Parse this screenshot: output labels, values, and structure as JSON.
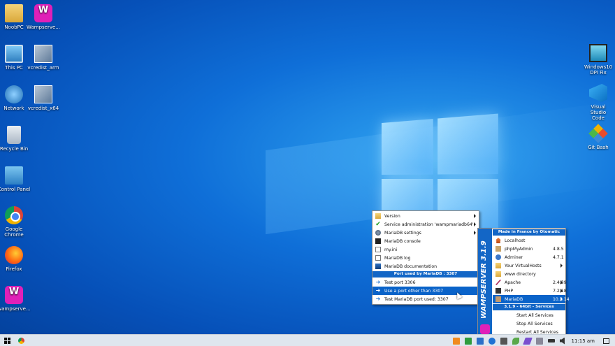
{
  "desktop": {
    "icons_left": [
      {
        "label": "NoobPC",
        "icon": "user-folder-icon"
      },
      {
        "label": "Wampserve...",
        "icon": "wampserver-icon"
      },
      {
        "label": "This PC",
        "icon": "this-pc-icon"
      },
      {
        "label": "vcredist_arm",
        "icon": "installer-icon"
      },
      {
        "label": "Network",
        "icon": "network-icon"
      },
      {
        "label": "vcredist_x64",
        "icon": "installer-icon"
      },
      {
        "label": "Recycle Bin",
        "icon": "recycle-bin-icon"
      },
      {
        "label": "Control Panel",
        "icon": "control-panel-icon"
      },
      {
        "label": "Google Chrome",
        "icon": "chrome-icon"
      },
      {
        "label": "Firefox",
        "icon": "firefox-icon"
      },
      {
        "label": "wampserve...",
        "icon": "wampserver-icon"
      }
    ],
    "icons_right": [
      {
        "label": "Windows10 DPI Fix",
        "icon": "dpi-fix-icon"
      },
      {
        "label": "Visual Studio Code",
        "icon": "vscode-icon"
      },
      {
        "label": "Git Bash",
        "icon": "git-bash-icon"
      }
    ]
  },
  "mariadb_menu": {
    "items": [
      {
        "label": "Version",
        "submenu": true
      },
      {
        "label": "Service administration 'wampmariadb64'",
        "submenu": true
      },
      {
        "label": "MariaDB settings",
        "submenu": true
      },
      {
        "label": "MariaDB console"
      },
      {
        "label": "my.ini"
      },
      {
        "label": "MariaDB log"
      },
      {
        "label": "MariaDB documentation"
      }
    ],
    "port_header": "Port used by MariaDB : 3307",
    "port_items": [
      {
        "label": "Test port 3306"
      },
      {
        "label": "Use a port other than 3307",
        "selected": true
      },
      {
        "label": "Test MariaDB port used: 3307"
      }
    ]
  },
  "wamp_menu": {
    "sidebar_text": "WAMPSERVER 3.1.9",
    "header": "Made in France by Otomatic",
    "items": [
      {
        "label": "Localhost",
        "version": ""
      },
      {
        "label": "phpMyAdmin",
        "version": "4.8.5"
      },
      {
        "label": "Adminer",
        "version": "4.7.1"
      },
      {
        "label": "Your VirtualHosts",
        "version": "",
        "submenu": true
      },
      {
        "label": "www directory",
        "version": ""
      },
      {
        "label": "Apache",
        "version": "2.4.39",
        "submenu": true
      },
      {
        "label": "PHP",
        "version": "7.2.18",
        "submenu": true
      },
      {
        "label": "MariaDB",
        "version": "10.3.14",
        "submenu": true,
        "selected": true
      }
    ],
    "services_header": "3.1.9 - 64bit - Services",
    "service_items": [
      {
        "label": "Start All Services"
      },
      {
        "label": "Stop All Services"
      },
      {
        "label": "Restart All Services"
      }
    ]
  },
  "taskbar": {
    "clock": "11:15 am"
  }
}
